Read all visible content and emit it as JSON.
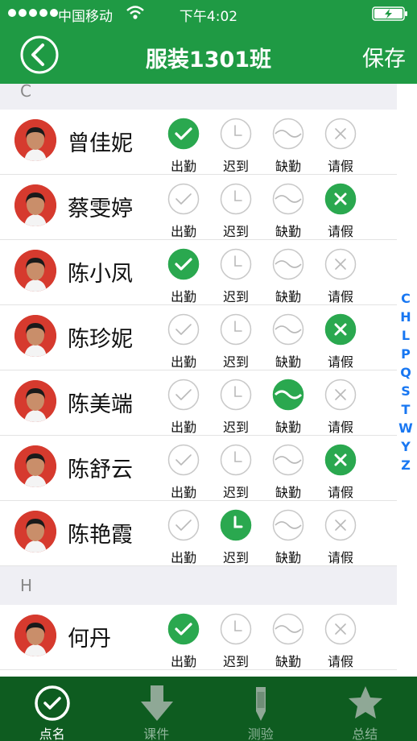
{
  "status_bar": {
    "carrier": "中国移动",
    "time": "下午4:02"
  },
  "nav": {
    "title": "服装1301班",
    "save_label": "保存"
  },
  "options": [
    "出勤",
    "迟到",
    "缺勤",
    "请假"
  ],
  "sections": [
    {
      "letter": "C",
      "students": [
        {
          "name": "曾佳妮",
          "status": 0
        },
        {
          "name": "蔡雯婷",
          "status": 3
        },
        {
          "name": "陈小凤",
          "status": 0
        },
        {
          "name": "陈珍妮",
          "status": 3
        },
        {
          "name": "陈美端",
          "status": 2
        },
        {
          "name": "陈舒云",
          "status": 3
        },
        {
          "name": "陈艳霞",
          "status": 1
        }
      ]
    },
    {
      "letter": "H",
      "students": [
        {
          "name": "何丹",
          "status": 0
        }
      ]
    }
  ],
  "index_letters": [
    "C",
    "H",
    "L",
    "P",
    "Q",
    "S",
    "T",
    "W",
    "Y",
    "Z"
  ],
  "tabs": [
    {
      "label": "点名",
      "icon": "check-circle-icon",
      "active": true
    },
    {
      "label": "课件",
      "icon": "download-arrow-icon",
      "active": false
    },
    {
      "label": "测验",
      "icon": "pencil-icon",
      "active": false
    },
    {
      "label": "总结",
      "icon": "star-icon",
      "active": false
    }
  ],
  "colors": {
    "primary": "#1f9a44",
    "tabbar": "#0e5c20",
    "selected": "#2aa84f",
    "index": "#1877f2"
  }
}
